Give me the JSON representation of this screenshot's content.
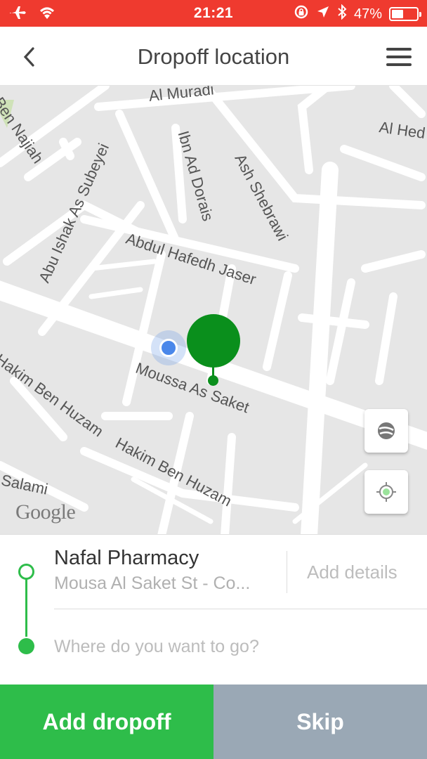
{
  "status_bar": {
    "time": "21:21",
    "battery_text": "47%",
    "battery_level": 0.47,
    "icons": [
      "airplane-icon",
      "wifi-icon",
      "orientation-lock-icon",
      "location-arrow-icon",
      "bluetooth-icon",
      "battery-icon"
    ]
  },
  "header": {
    "title": "Dropoff location",
    "back_icon": "chevron-left-icon",
    "menu_icon": "hamburger-menu-icon"
  },
  "map": {
    "streets": [
      "Al Muradi",
      "Ben Najiah",
      "Abu Ishak As Subeyei",
      "Ibn Ad Dorais",
      "Ash Shebrawi",
      "Al Hed",
      "Abdul Hafedh Jaser",
      "Moussa As Saket",
      "Hakim Ben Huzam",
      "Hakim Ben Huzam",
      "Salami"
    ],
    "attribution": "Google",
    "buttons": [
      "satellite-toggle-icon",
      "my-location-icon"
    ]
  },
  "trip": {
    "origin_name": "Nafal Pharmacy",
    "origin_address": "Mousa Al Saket St - Co...",
    "add_details": "Add details",
    "destination_placeholder": "Where do you want to go?"
  },
  "actions": {
    "add_dropoff": "Add dropoff",
    "skip": "Skip"
  },
  "colors": {
    "status_bar": "#ef3a2f",
    "accent_green": "#2ebd4a",
    "pin_green": "#0a8f1c",
    "skip_gray": "#9aa8b5",
    "user_blue": "#4a87ea"
  }
}
